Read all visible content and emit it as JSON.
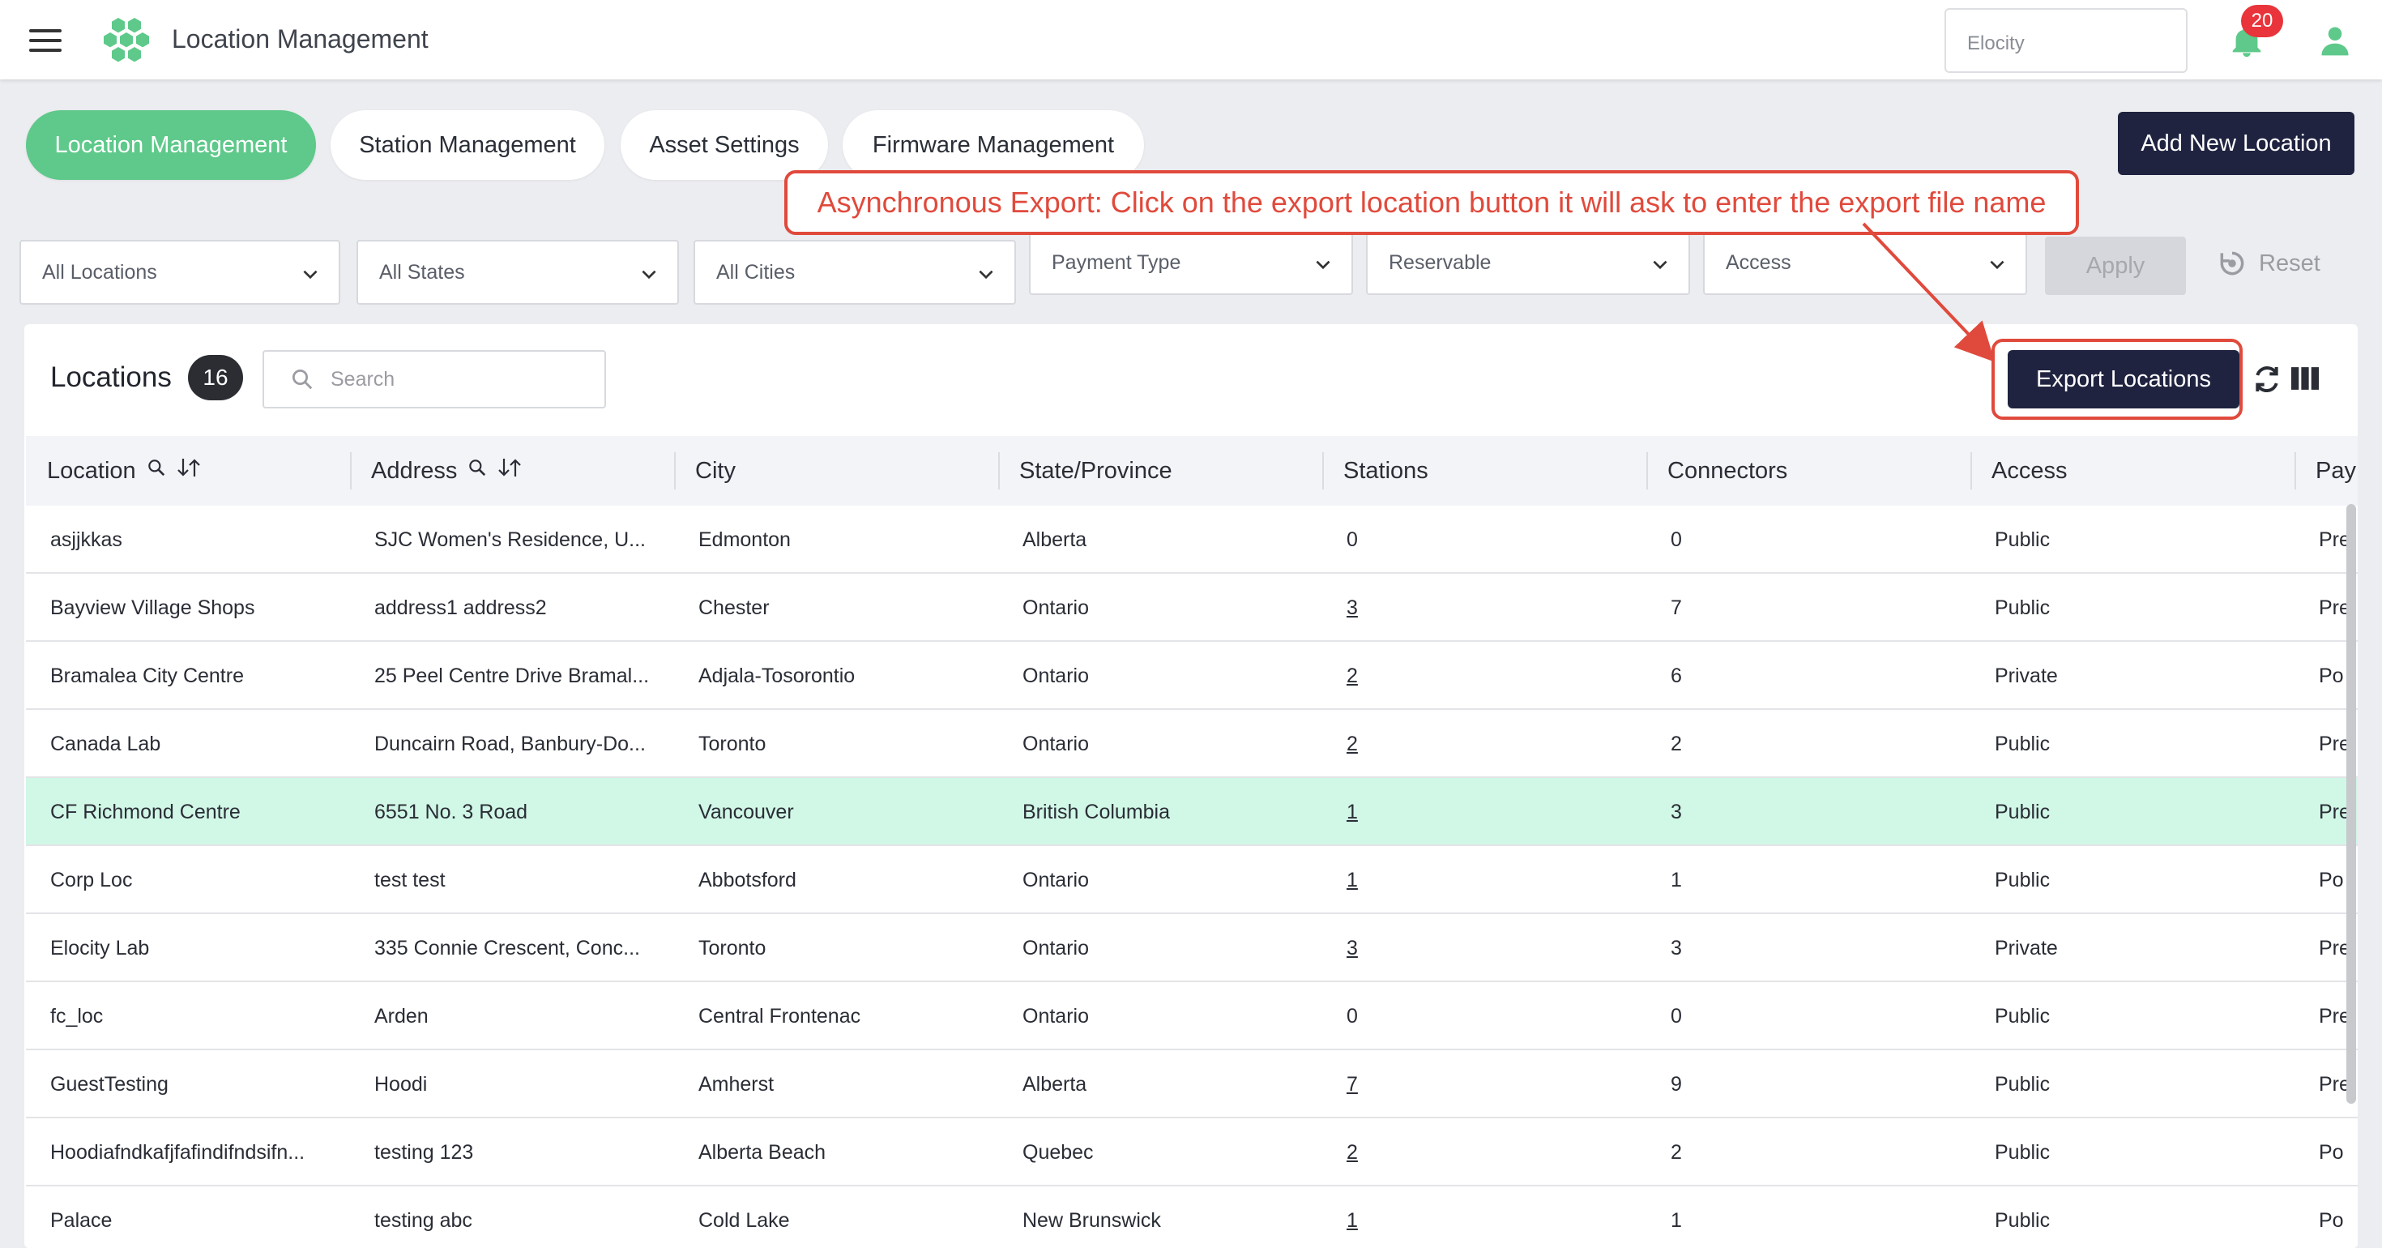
{
  "appbar": {
    "title": "Location Management",
    "tenant_placeholder": "Elocity",
    "notification_count": "20"
  },
  "tabs": [
    {
      "label": "Location Management",
      "active": true
    },
    {
      "label": "Station Management",
      "active": false
    },
    {
      "label": "Asset Settings",
      "active": false
    },
    {
      "label": "Firmware Management",
      "active": false
    }
  ],
  "add_button_label": "Add New Location",
  "annotation": "Asynchronous Export: Click on the export location button it will ask to enter the export file name",
  "filters": {
    "locations": "All Locations",
    "states": "All States",
    "cities": "All Cities",
    "payment_type": "Payment Type",
    "reservable": "Reservable",
    "access": "Access",
    "apply": "Apply",
    "reset": "Reset"
  },
  "card": {
    "title": "Locations",
    "count": "16",
    "search_placeholder": "Search",
    "export_label": "Export Locations"
  },
  "table": {
    "columns": [
      "Location",
      "Address",
      "City",
      "State/Province",
      "Stations",
      "Connectors",
      "Access",
      "Pay"
    ],
    "rows": [
      {
        "location": "asjjkkas",
        "address": "SJC Women's Residence, U...",
        "city": "Edmonton",
        "state": "Alberta",
        "stations": "0",
        "connectors": "0",
        "access": "Public",
        "pay": "Pre"
      },
      {
        "location": "Bayview Village Shops",
        "address": "address1 address2",
        "city": "Chester",
        "state": "Ontario",
        "stations": "3",
        "connectors": "7",
        "access": "Public",
        "pay": "Pre"
      },
      {
        "location": "Bramalea City Centre",
        "address": "25 Peel Centre Drive Bramal...",
        "city": "Adjala-Tosorontio",
        "state": "Ontario",
        "stations": "2",
        "connectors": "6",
        "access": "Private",
        "pay": "Po"
      },
      {
        "location": "Canada Lab",
        "address": "Duncairn Road, Banbury-Do...",
        "city": "Toronto",
        "state": "Ontario",
        "stations": "2",
        "connectors": "2",
        "access": "Public",
        "pay": "Pre"
      },
      {
        "location": "CF Richmond Centre",
        "address": "6551 No. 3 Road",
        "city": "Vancouver",
        "state": "British Columbia",
        "stations": "1",
        "connectors": "3",
        "access": "Public",
        "pay": "Pre"
      },
      {
        "location": "Corp Loc",
        "address": "test test",
        "city": "Abbotsford",
        "state": "Ontario",
        "stations": "1",
        "connectors": "1",
        "access": "Public",
        "pay": "Po"
      },
      {
        "location": "Elocity Lab",
        "address": "335 Connie Crescent, Conc...",
        "city": "Toronto",
        "state": "Ontario",
        "stations": "3",
        "connectors": "3",
        "access": "Private",
        "pay": "Pre"
      },
      {
        "location": "fc_loc",
        "address": "Arden",
        "city": "Central Frontenac",
        "state": "Ontario",
        "stations": "0",
        "connectors": "0",
        "access": "Public",
        "pay": "Pre"
      },
      {
        "location": "GuestTesting",
        "address": "Hoodi",
        "city": "Amherst",
        "state": "Alberta",
        "stations": "7",
        "connectors": "9",
        "access": "Public",
        "pay": "Pre"
      },
      {
        "location": "Hoodiafndkafjfafindifndsifn...",
        "address": "testing 123",
        "city": "Alberta Beach",
        "state": "Quebec",
        "stations": "2",
        "connectors": "2",
        "access": "Public",
        "pay": "Po"
      },
      {
        "location": "Palace",
        "address": "testing abc",
        "city": "Cold Lake",
        "state": "New Brunswick",
        "stations": "1",
        "connectors": "1",
        "access": "Public",
        "pay": "Po"
      }
    ]
  },
  "colors": {
    "accent_green": "#5ec98a",
    "navy_button": "#1f2340",
    "annotation_red": "#e04a3c",
    "highlight_row": "#d1f7e7"
  }
}
